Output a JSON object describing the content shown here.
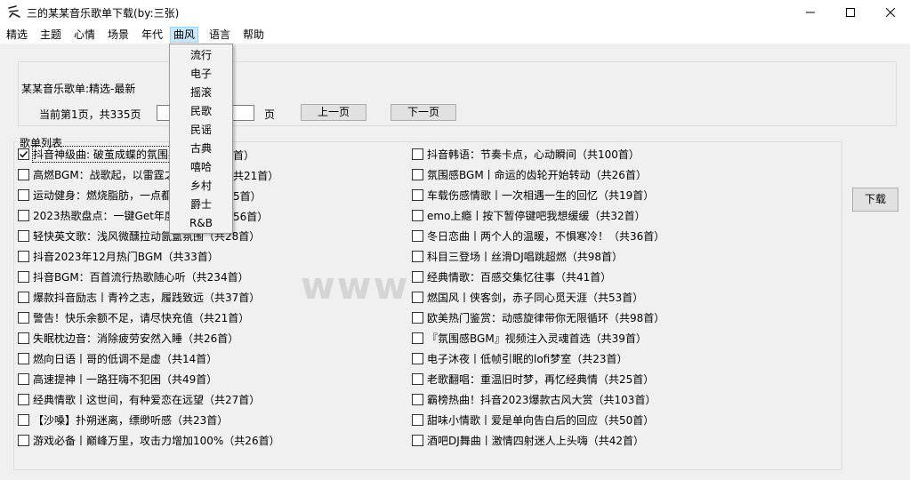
{
  "window": {
    "title": "三的某某音乐歌单下载(by:三张)",
    "icon": "app-icon",
    "controls": {
      "minimize": "─",
      "maximize": "☐",
      "close": "✕"
    }
  },
  "menu": [
    "精选",
    "主题",
    "心情",
    "场景",
    "年代",
    "曲风",
    "语言",
    "帮助"
  ],
  "active_menu": "曲风",
  "dropdown": [
    "流行",
    "电子",
    "摇滚",
    "民歌",
    "民谣",
    "古典",
    "嘻哈",
    "乡村",
    "爵士",
    "R&B"
  ],
  "header": {
    "label": "某某音乐歌单:精选-最新",
    "page_info": "当前第1页，共335页",
    "page_unit": "页",
    "prev_label": "上一页",
    "next_label": "下一页",
    "page_input_value": ""
  },
  "list": {
    "caption": "歌单列表",
    "left": [
      "抖音神级曲: 破茧成蝶的氛围感（共",
      "高燃BGM：战歌起，以雷霆之",
      "运动健身：燃烧脂肪，一点都",
      "2023热歌盘点：一键Get年度",
      "轻快英文歌：浅风微醺拉动氤氲氛围（共28首）",
      "抖音2023年12月热门BGM（共33首）",
      "抖音BGM：百首流行热歌随心听（共234首）",
      "爆款抖音励志丨青衿之志，履践致远（共37首）",
      "警告！快乐余额不足，请尽快充值（共21首）",
      "失眠枕边音：消除疲劳安然入睡（共26首）",
      "燃向日语丨哥的低调不是虚（共14首）",
      "高速提神丨一路狂嗨不犯困（共49首）",
      "经典情歌丨这世间，有种爱恋在远望（共27首）",
      "【沙嗓】扑朔迷离，缥缈听感（共23首）",
      "游戏必备丨巅峰万里，攻击力增加100%（共26首）"
    ],
    "left_hidden_tail": [
      "首）",
      "共21首）",
      "5首）",
      "56首）"
    ],
    "right": [
      "抖音韩语：节奏卡点，心动瞬间（共100首）",
      "氛围感BGM丨命运的齿轮开始转动（共26首）",
      "车载伤感情歌丨一次相遇一生的回忆（共19首）",
      "emo上瘾丨按下暂停键吧我想缓缓（共32首）",
      "冬日恋曲丨两个人的温暖，不惧寒冷！（共36首）",
      "科目三登场丨丝滑DJ唱跳超燃（共98首）",
      "经典情歌：百感交集忆往事（共41首）",
      "燃国风丨侠客剑，赤子同心觅天涯（共53首）",
      "欧美热门鉴赏：动感旋律带你无限循环（共98首）",
      "『氛围感BGM』视频注入灵魂首选（共39首）",
      "电子沐夜丨低帧引眠的lofi梦室（共23首）",
      "老歌翻唱：重温旧时梦，再忆经典情（共25首）",
      "霸榜热曲！抖音2023爆款古风大赏（共103首）",
      "甜味小情歌丨爱是单向告白后的回应（共50首）",
      "酒吧DJ舞曲丨激情四射迷人上头嗨（共42首）"
    ],
    "checked_left_index": 0
  },
  "download_label": "下载",
  "watermark": "www."
}
